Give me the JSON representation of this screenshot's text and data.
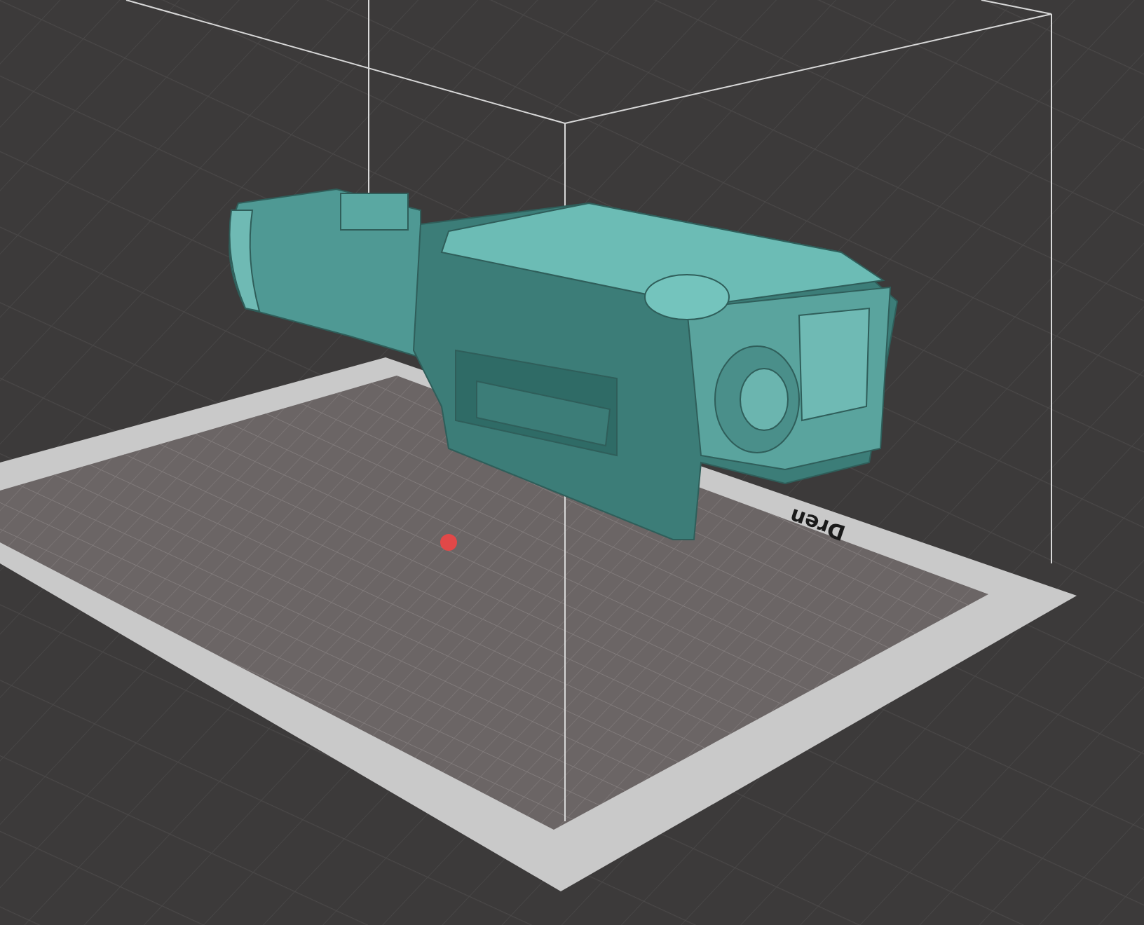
{
  "viewport": {
    "bed_label": "Dren"
  }
}
